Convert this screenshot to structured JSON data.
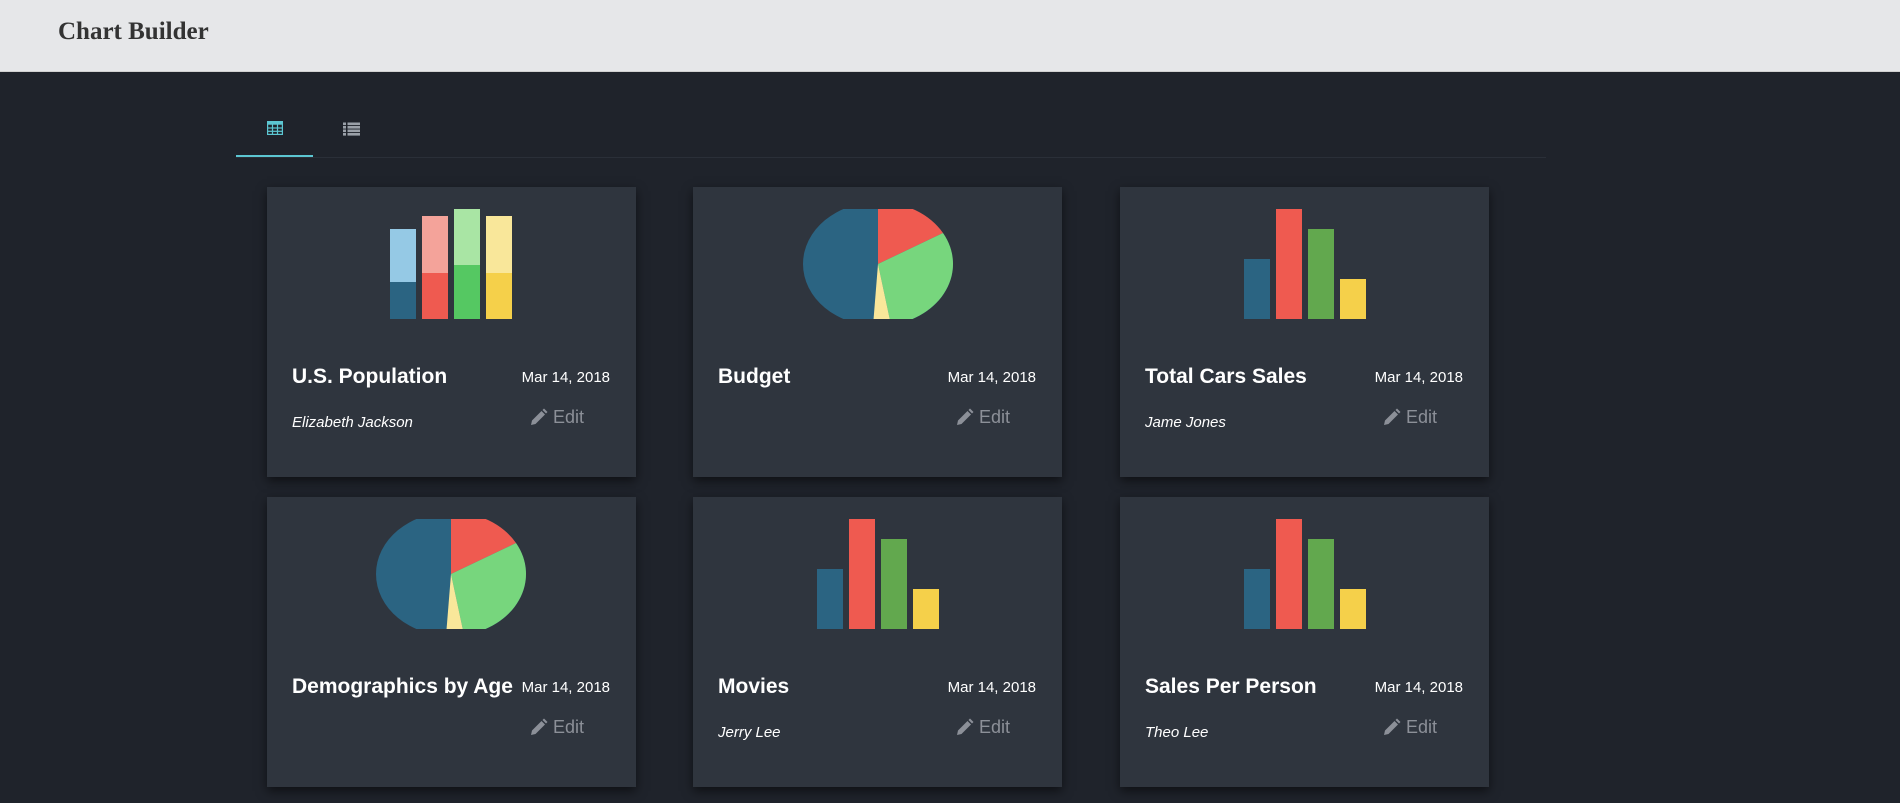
{
  "app": {
    "title": "Chart Builder"
  },
  "view_tabs": [
    {
      "icon": "grid-icon",
      "active": true
    },
    {
      "icon": "list-icon",
      "active": false
    }
  ],
  "colors": {
    "accent": "#5cc6d2",
    "blue": "#2b6482",
    "red": "#ef5a50",
    "green": "#77d67d",
    "dark_green": "#62a84e",
    "yellow": "#f5d04a",
    "pale_yellow": "#f9e79a"
  },
  "edit_label": "Edit",
  "cards": [
    {
      "title": "U.S. Population",
      "date": "Mar 14, 2018",
      "author": "Elizabeth Jackson",
      "thumbnail": "stacked-bar-chart-icon"
    },
    {
      "title": "Budget",
      "date": "Mar 14, 2018",
      "author": "",
      "thumbnail": "pie-chart-icon"
    },
    {
      "title": "Total Cars Sales",
      "date": "Mar 14, 2018",
      "author": "Jame Jones",
      "thumbnail": "bar-chart-icon"
    },
    {
      "title": "Demographics by Age",
      "date": "Mar 14, 2018",
      "author": "",
      "thumbnail": "pie-chart-icon"
    },
    {
      "title": "Movies",
      "date": "Mar 14, 2018",
      "author": "Jerry Lee",
      "thumbnail": "bar-chart-icon"
    },
    {
      "title": "Sales Per Person",
      "date": "Mar 14, 2018",
      "author": "Theo Lee",
      "thumbnail": "bar-chart-icon"
    }
  ]
}
